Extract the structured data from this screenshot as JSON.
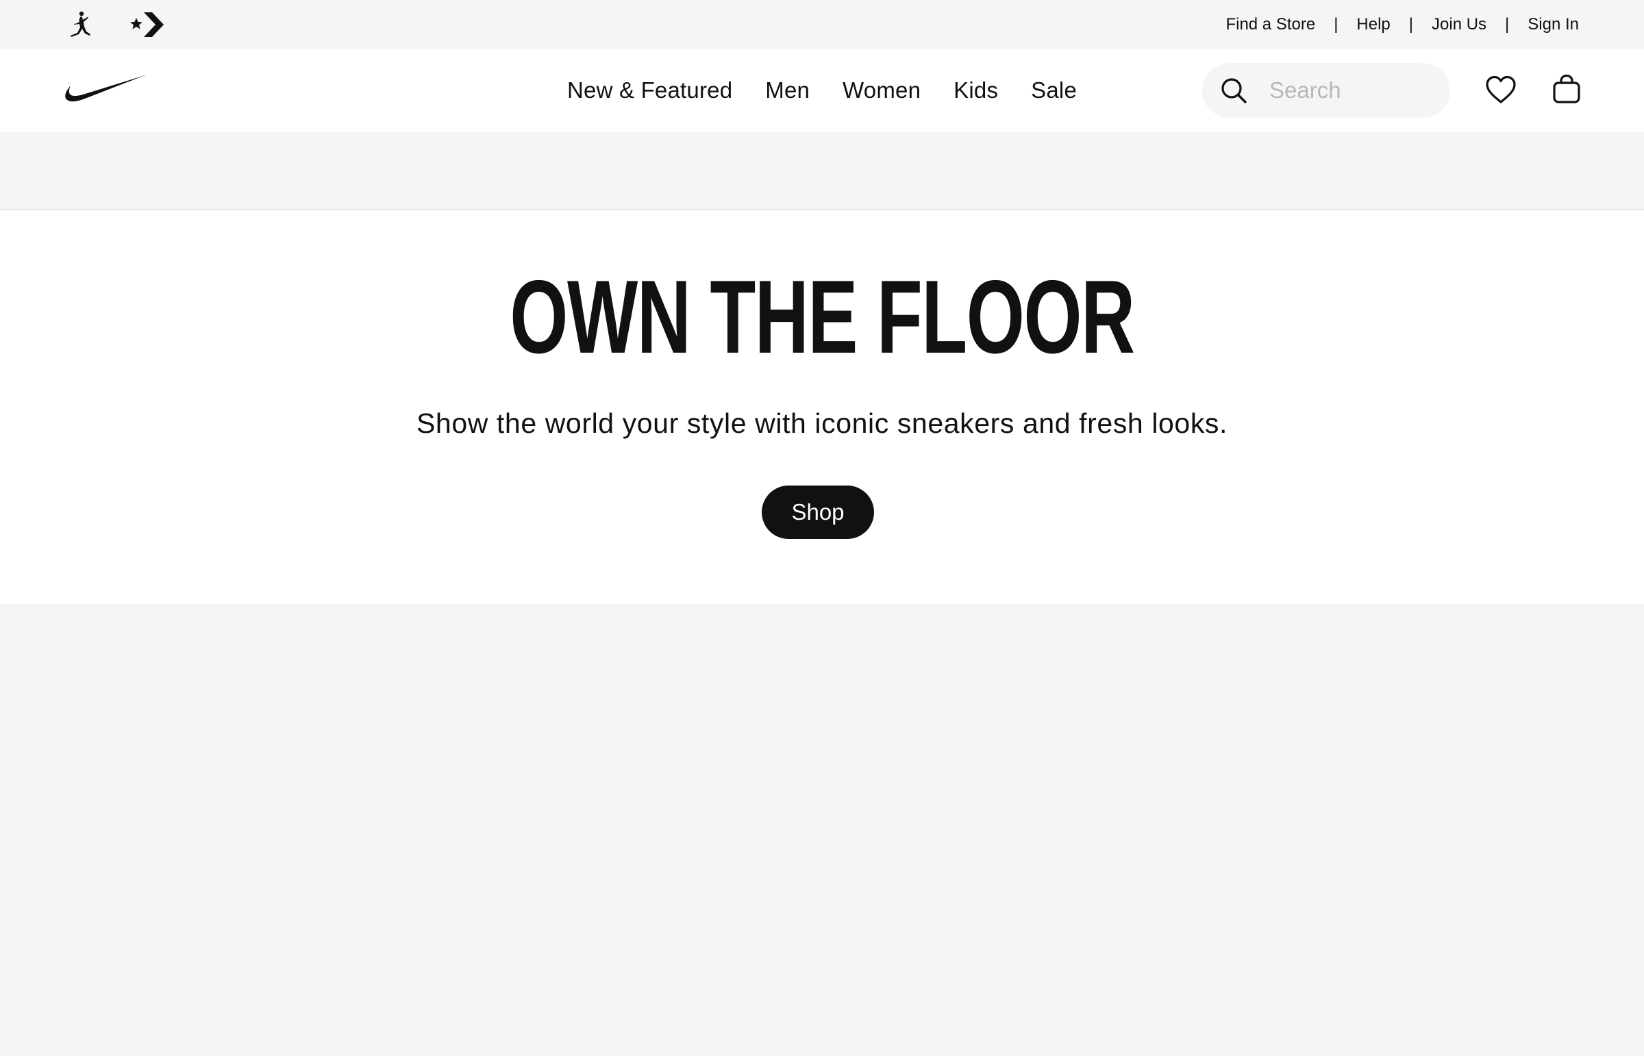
{
  "utility_bar": {
    "brand_icons": [
      "jordan-jumpman-icon",
      "converse-star-chevron-icon"
    ],
    "links": [
      {
        "label": "Find a Store"
      },
      {
        "label": "Help"
      },
      {
        "label": "Join Us"
      },
      {
        "label": "Sign In"
      }
    ],
    "separator": "|"
  },
  "header": {
    "logo": "nike-swoosh-icon",
    "nav": [
      {
        "label": "New & Featured"
      },
      {
        "label": "Men"
      },
      {
        "label": "Women"
      },
      {
        "label": "Kids"
      },
      {
        "label": "Sale"
      }
    ],
    "search": {
      "placeholder": "Search",
      "value": "",
      "icon": "search-icon"
    },
    "favorites_icon": "heart-icon",
    "bag_icon": "shopping-bag-icon"
  },
  "hero": {
    "title": "OWN THE FLOOR",
    "subtitle": "Show the world your style with iconic sneakers and fresh looks.",
    "cta_label": "Shop"
  },
  "colors": {
    "text": "#111111",
    "background": "#f5f5f5",
    "surface": "#ffffff",
    "button_bg": "#111111",
    "button_text": "#ffffff",
    "placeholder": "#b7b7b7"
  }
}
